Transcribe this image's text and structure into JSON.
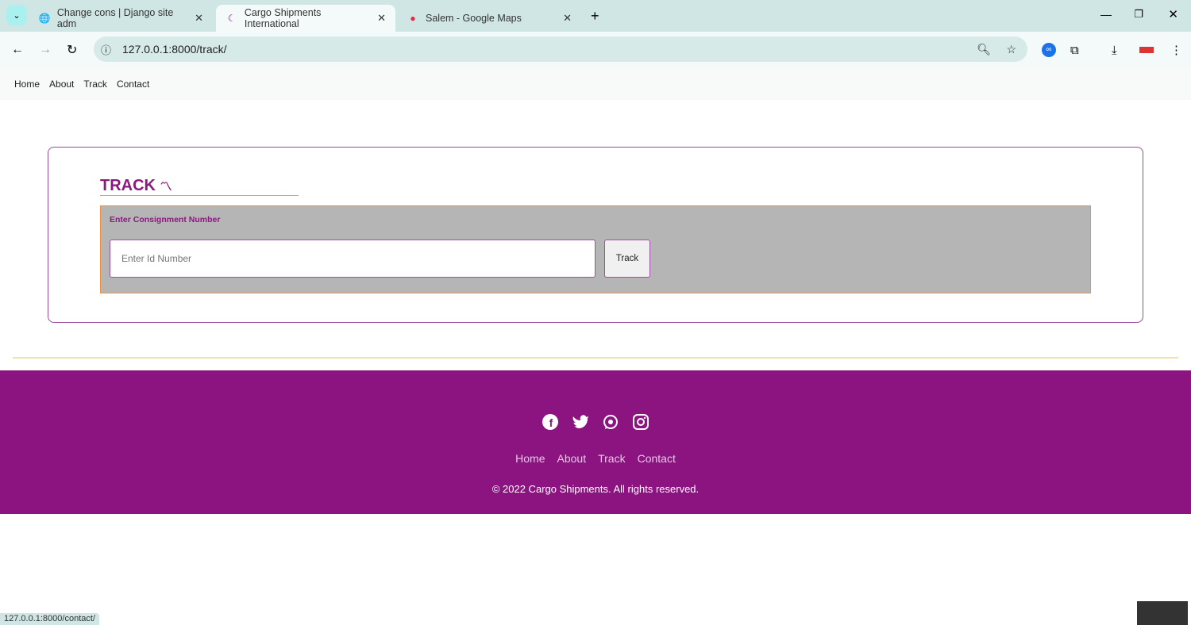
{
  "browser": {
    "tabs": [
      {
        "title": "Change cons | Django site adm",
        "icon": "globe-icon"
      },
      {
        "title": "Cargo Shipments International",
        "icon": "cargo-logo-icon",
        "active": true
      },
      {
        "title": "Salem - Google Maps",
        "icon": "maps-pin-icon"
      }
    ],
    "url": "127.0.0.1:8000/track/",
    "status_url": "127.0.0.1:8000/contact/"
  },
  "nav": {
    "items": [
      "Home",
      "About",
      "Track",
      "Contact"
    ]
  },
  "track": {
    "title": "TRACK",
    "label": "Enter Consignment Number",
    "placeholder": "Enter Id Number",
    "button": "Track"
  },
  "footer": {
    "social": [
      "facebook-icon",
      "twitter-icon",
      "whatsapp-icon",
      "instagram-icon"
    ],
    "links": [
      "Home",
      "About",
      "Track",
      "Contact"
    ],
    "copyright": "© 2022 Cargo Shipments. All rights reserved."
  },
  "colors": {
    "brand": "#8b1480",
    "accent": "#f09040"
  }
}
